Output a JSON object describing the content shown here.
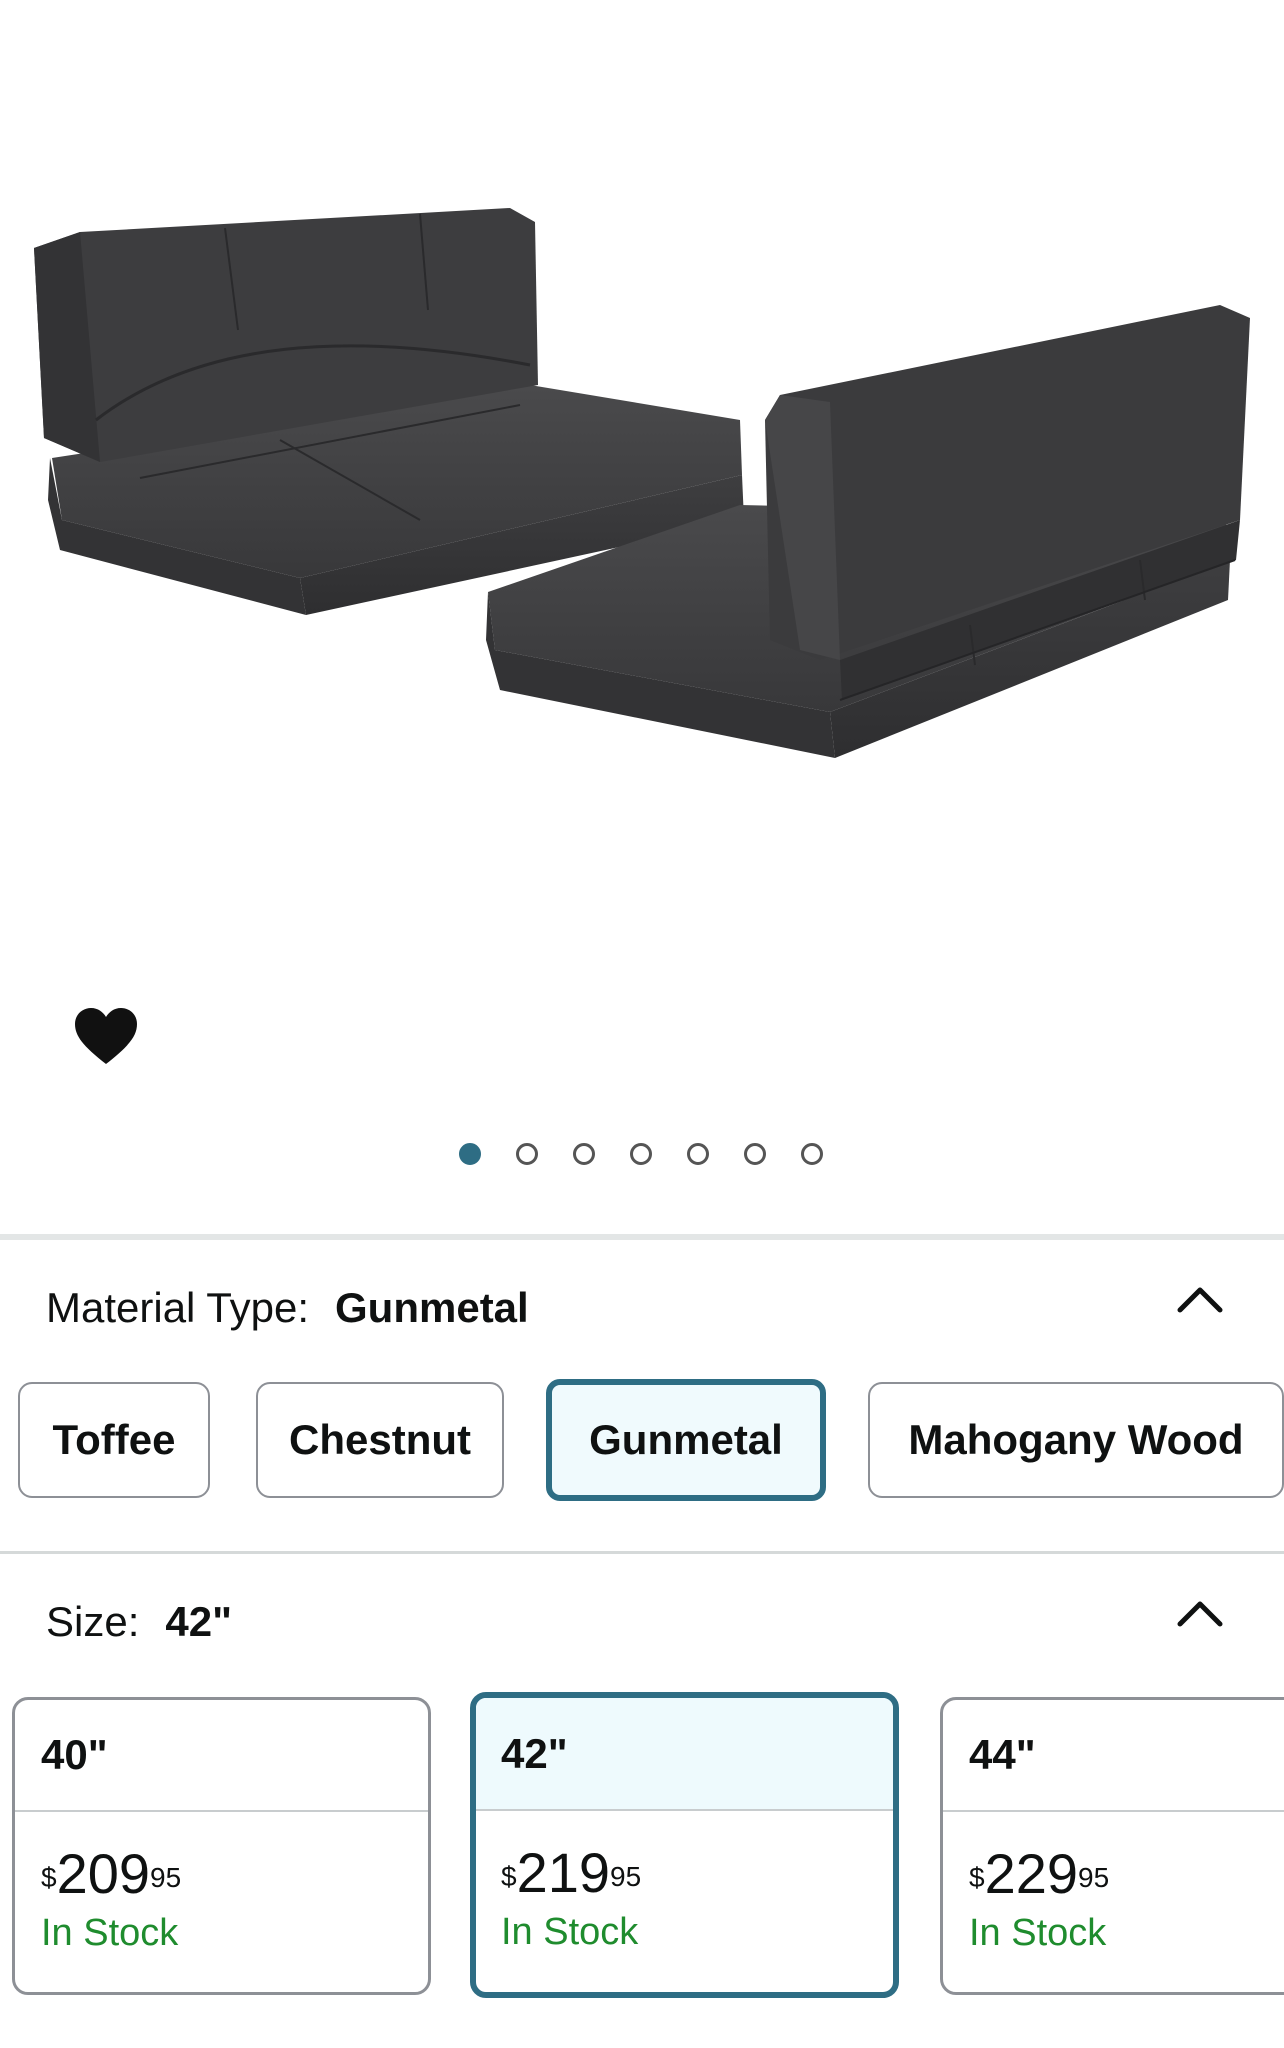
{
  "gallery": {
    "image_count": 7,
    "active_index": 0,
    "favorite_icon": "heart-icon"
  },
  "material": {
    "label": "Material Type:",
    "selected_value": "Gunmetal",
    "options": [
      {
        "label": "Toffee",
        "selected": false
      },
      {
        "label": "Chestnut",
        "selected": false
      },
      {
        "label": "Gunmetal",
        "selected": true
      },
      {
        "label": "Mahogany Wood",
        "selected": false
      }
    ]
  },
  "size": {
    "label": "Size:",
    "selected_value": "42\"",
    "options": [
      {
        "label": "40\"",
        "currency": "$",
        "whole": "209",
        "cents": "95",
        "stock": "In Stock",
        "selected": false
      },
      {
        "label": "42\"",
        "currency": "$",
        "whole": "219",
        "cents": "95",
        "stock": "In Stock",
        "selected": true
      },
      {
        "label": "44\"",
        "currency": "$",
        "whole": "229",
        "cents": "95",
        "stock": "In Stock",
        "selected": false
      }
    ]
  },
  "colors": {
    "accent": "#2e6d84",
    "in_stock": "#1f8c2e",
    "product": "#3c3c3e"
  }
}
